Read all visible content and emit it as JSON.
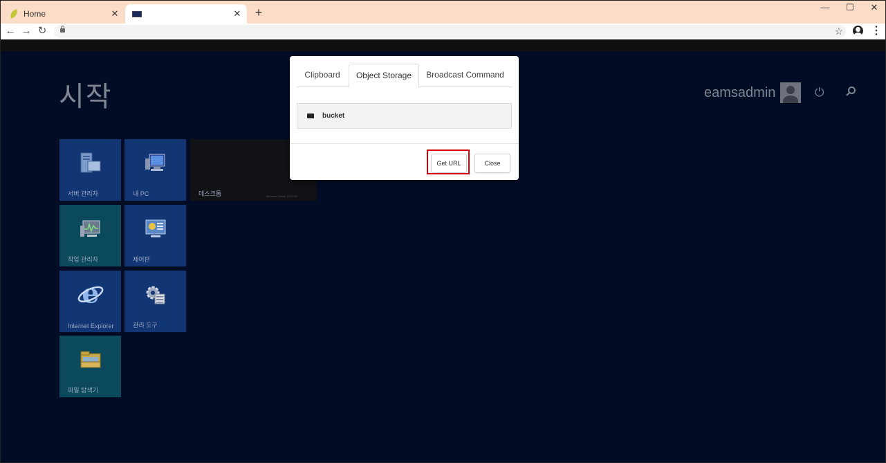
{
  "browser": {
    "tabs": [
      {
        "label": "Home",
        "icon": "leaf-icon"
      },
      {
        "label": "",
        "icon": "monitor-icon"
      }
    ],
    "new_tab": "+",
    "window_controls": {
      "minimize": "—",
      "maximize": "☐",
      "close": "✕"
    },
    "nav": {
      "back": "←",
      "forward": "→",
      "reload": "↻"
    },
    "address": "",
    "bookmark": "☆",
    "menu": "⋮"
  },
  "desktop": {
    "title": "시작",
    "username": "eamsadmin",
    "power_icon": "⏻",
    "tiles": [
      {
        "label": "서버 관리자",
        "icon": "server-manager-icon"
      },
      {
        "label": "내 PC",
        "icon": "computer-icon"
      },
      {
        "label": "데스크톱",
        "icon": "desktop-icon",
        "sublabel": "Windows Server 2012 R2"
      },
      {
        "label": "작업 관리자",
        "icon": "task-manager-icon"
      },
      {
        "label": "제어판",
        "icon": "control-panel-icon"
      },
      {
        "label": "Internet Explorer",
        "icon": "internet-explorer-icon"
      },
      {
        "label": "관리 도구",
        "icon": "admin-tools-icon"
      },
      {
        "label": "파일 탐색기",
        "icon": "file-explorer-icon"
      }
    ]
  },
  "modal": {
    "tabs": [
      "Clipboard",
      "Object Storage",
      "Broadcast Command"
    ],
    "active_tab": "Object Storage",
    "storage_items": [
      {
        "name": "bucket",
        "icon": "drive-icon"
      }
    ],
    "buttons": {
      "get_url": "Get URL",
      "close": "Close"
    },
    "highlight_color": "#d20000"
  }
}
